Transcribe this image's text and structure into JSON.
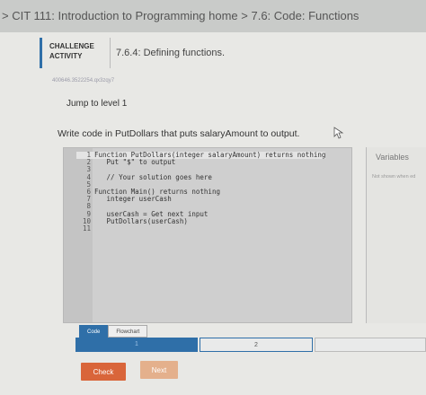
{
  "breadcrumb": {
    "text": "> CIT 111: Introduction to Programming home > 7.6: Code: Functions"
  },
  "activity": {
    "type_line1": "CHALLENGE",
    "type_line2": "ACTIVITY",
    "title": "7.6.4: Defining functions.",
    "id": "400646.3522254.qx3zqy7"
  },
  "jump_label": "Jump to level 1",
  "prompt": "Write code in PutDollars that puts salaryAmount to output.",
  "editor": {
    "lines": [
      {
        "n": "1",
        "text": "Function PutDollars(integer salaryAmount) returns nothing"
      },
      {
        "n": "2",
        "text": "   Put \"$\" to output"
      },
      {
        "n": "3",
        "text": ""
      },
      {
        "n": "4",
        "text": "   // Your solution goes here"
      },
      {
        "n": "5",
        "text": ""
      },
      {
        "n": "6",
        "text": "Function Main() returns nothing"
      },
      {
        "n": "7",
        "text": "   integer userCash"
      },
      {
        "n": "8",
        "text": ""
      },
      {
        "n": "9",
        "text": "   userCash = Get next input"
      },
      {
        "n": "10",
        "text": "   PutDollars(userCash)"
      },
      {
        "n": "11",
        "text": ""
      }
    ]
  },
  "variables": {
    "title": "Variables",
    "note": "Not shown when ed"
  },
  "tabs": {
    "code": "Code",
    "flowchart": "Flowchart"
  },
  "levels": {
    "l1": "1",
    "l2": "2",
    "l3": ""
  },
  "buttons": {
    "check": "Check",
    "next": "Next"
  },
  "colors": {
    "accent": "#2f6fa8",
    "check": "#d9653a",
    "next": "#e4b08c"
  }
}
